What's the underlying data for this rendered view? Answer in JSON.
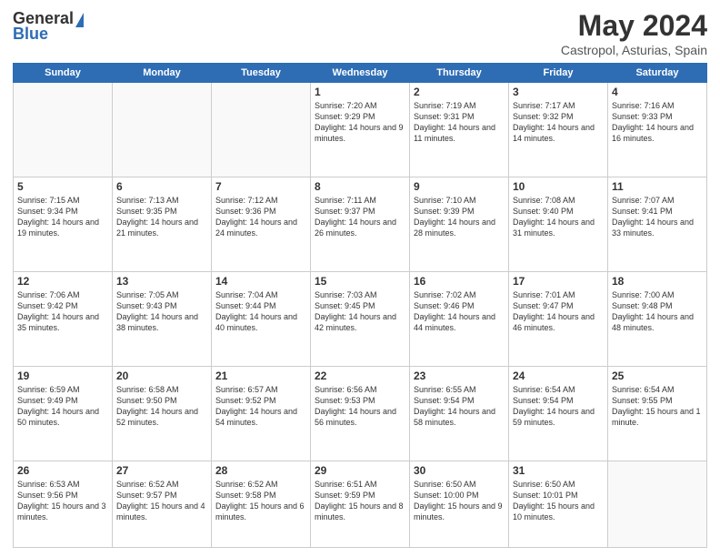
{
  "header": {
    "logo_general": "General",
    "logo_blue": "Blue",
    "month_year": "May 2024",
    "location": "Castropol, Asturias, Spain"
  },
  "weekdays": [
    "Sunday",
    "Monday",
    "Tuesday",
    "Wednesday",
    "Thursday",
    "Friday",
    "Saturday"
  ],
  "weeks": [
    [
      {
        "day": "",
        "text": ""
      },
      {
        "day": "",
        "text": ""
      },
      {
        "day": "",
        "text": ""
      },
      {
        "day": "1",
        "text": "Sunrise: 7:20 AM\nSunset: 9:29 PM\nDaylight: 14 hours\nand 9 minutes."
      },
      {
        "day": "2",
        "text": "Sunrise: 7:19 AM\nSunset: 9:31 PM\nDaylight: 14 hours\nand 11 minutes."
      },
      {
        "day": "3",
        "text": "Sunrise: 7:17 AM\nSunset: 9:32 PM\nDaylight: 14 hours\nand 14 minutes."
      },
      {
        "day": "4",
        "text": "Sunrise: 7:16 AM\nSunset: 9:33 PM\nDaylight: 14 hours\nand 16 minutes."
      }
    ],
    [
      {
        "day": "5",
        "text": "Sunrise: 7:15 AM\nSunset: 9:34 PM\nDaylight: 14 hours\nand 19 minutes."
      },
      {
        "day": "6",
        "text": "Sunrise: 7:13 AM\nSunset: 9:35 PM\nDaylight: 14 hours\nand 21 minutes."
      },
      {
        "day": "7",
        "text": "Sunrise: 7:12 AM\nSunset: 9:36 PM\nDaylight: 14 hours\nand 24 minutes."
      },
      {
        "day": "8",
        "text": "Sunrise: 7:11 AM\nSunset: 9:37 PM\nDaylight: 14 hours\nand 26 minutes."
      },
      {
        "day": "9",
        "text": "Sunrise: 7:10 AM\nSunset: 9:39 PM\nDaylight: 14 hours\nand 28 minutes."
      },
      {
        "day": "10",
        "text": "Sunrise: 7:08 AM\nSunset: 9:40 PM\nDaylight: 14 hours\nand 31 minutes."
      },
      {
        "day": "11",
        "text": "Sunrise: 7:07 AM\nSunset: 9:41 PM\nDaylight: 14 hours\nand 33 minutes."
      }
    ],
    [
      {
        "day": "12",
        "text": "Sunrise: 7:06 AM\nSunset: 9:42 PM\nDaylight: 14 hours\nand 35 minutes."
      },
      {
        "day": "13",
        "text": "Sunrise: 7:05 AM\nSunset: 9:43 PM\nDaylight: 14 hours\nand 38 minutes."
      },
      {
        "day": "14",
        "text": "Sunrise: 7:04 AM\nSunset: 9:44 PM\nDaylight: 14 hours\nand 40 minutes."
      },
      {
        "day": "15",
        "text": "Sunrise: 7:03 AM\nSunset: 9:45 PM\nDaylight: 14 hours\nand 42 minutes."
      },
      {
        "day": "16",
        "text": "Sunrise: 7:02 AM\nSunset: 9:46 PM\nDaylight: 14 hours\nand 44 minutes."
      },
      {
        "day": "17",
        "text": "Sunrise: 7:01 AM\nSunset: 9:47 PM\nDaylight: 14 hours\nand 46 minutes."
      },
      {
        "day": "18",
        "text": "Sunrise: 7:00 AM\nSunset: 9:48 PM\nDaylight: 14 hours\nand 48 minutes."
      }
    ],
    [
      {
        "day": "19",
        "text": "Sunrise: 6:59 AM\nSunset: 9:49 PM\nDaylight: 14 hours\nand 50 minutes."
      },
      {
        "day": "20",
        "text": "Sunrise: 6:58 AM\nSunset: 9:50 PM\nDaylight: 14 hours\nand 52 minutes."
      },
      {
        "day": "21",
        "text": "Sunrise: 6:57 AM\nSunset: 9:52 PM\nDaylight: 14 hours\nand 54 minutes."
      },
      {
        "day": "22",
        "text": "Sunrise: 6:56 AM\nSunset: 9:53 PM\nDaylight: 14 hours\nand 56 minutes."
      },
      {
        "day": "23",
        "text": "Sunrise: 6:55 AM\nSunset: 9:54 PM\nDaylight: 14 hours\nand 58 minutes."
      },
      {
        "day": "24",
        "text": "Sunrise: 6:54 AM\nSunset: 9:54 PM\nDaylight: 14 hours\nand 59 minutes."
      },
      {
        "day": "25",
        "text": "Sunrise: 6:54 AM\nSunset: 9:55 PM\nDaylight: 15 hours\nand 1 minute."
      }
    ],
    [
      {
        "day": "26",
        "text": "Sunrise: 6:53 AM\nSunset: 9:56 PM\nDaylight: 15 hours\nand 3 minutes."
      },
      {
        "day": "27",
        "text": "Sunrise: 6:52 AM\nSunset: 9:57 PM\nDaylight: 15 hours\nand 4 minutes."
      },
      {
        "day": "28",
        "text": "Sunrise: 6:52 AM\nSunset: 9:58 PM\nDaylight: 15 hours\nand 6 minutes."
      },
      {
        "day": "29",
        "text": "Sunrise: 6:51 AM\nSunset: 9:59 PM\nDaylight: 15 hours\nand 8 minutes."
      },
      {
        "day": "30",
        "text": "Sunrise: 6:50 AM\nSunset: 10:00 PM\nDaylight: 15 hours\nand 9 minutes."
      },
      {
        "day": "31",
        "text": "Sunrise: 6:50 AM\nSunset: 10:01 PM\nDaylight: 15 hours\nand 10 minutes."
      },
      {
        "day": "",
        "text": ""
      }
    ]
  ]
}
